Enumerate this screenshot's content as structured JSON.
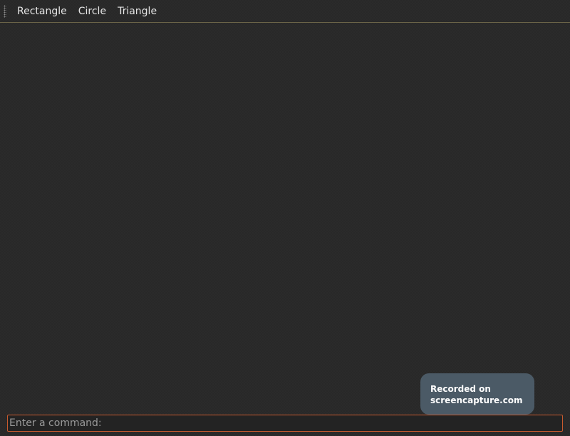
{
  "toolbar": {
    "items": [
      {
        "label": "Rectangle"
      },
      {
        "label": "Circle"
      },
      {
        "label": "Triangle"
      }
    ]
  },
  "watermark": {
    "line1": "Recorded on",
    "line2": "screencapture.com"
  },
  "command": {
    "value": "",
    "placeholder": "Enter a command:"
  },
  "colors": {
    "background": "#2b2b2b",
    "toolbar_border": "#6b6448",
    "input_border": "#c75a2e",
    "watermark_bg": "#4b5a66"
  }
}
